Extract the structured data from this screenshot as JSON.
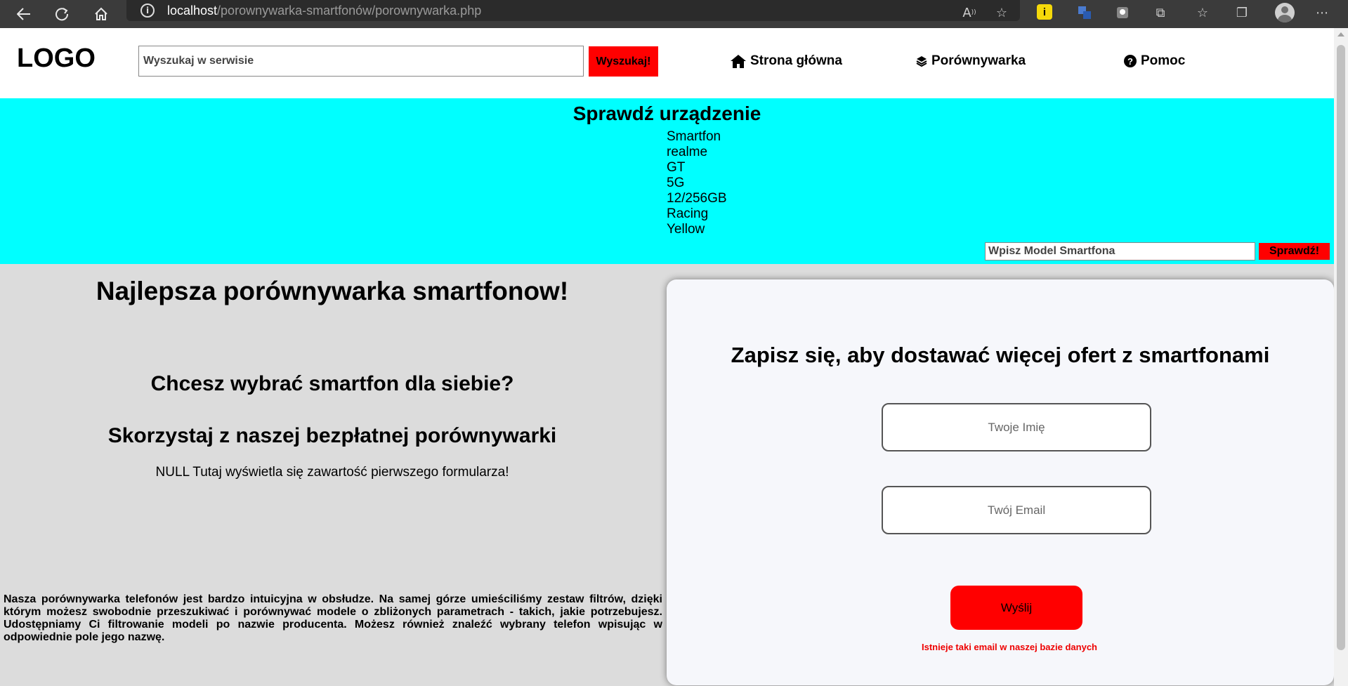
{
  "browser": {
    "url_host": "localhost",
    "url_path": "/porownywarka-smartfonów/porownywarka.php"
  },
  "header": {
    "logo": "LOGO",
    "search": {
      "placeholder": "Wyszukaj w serwisie",
      "button": "Wyszukaj!"
    },
    "nav": [
      {
        "label": "Strona główna",
        "icon": "home-icon"
      },
      {
        "label": "Porównywarka",
        "icon": "layers-icon"
      },
      {
        "label": "Pomoc",
        "icon": "question-icon"
      }
    ]
  },
  "device_check": {
    "title": "Sprawdź urządzenie",
    "lines": [
      "Smartfon",
      "realme",
      "GT",
      "5G",
      "12/256GB",
      "Racing",
      "Yellow"
    ],
    "input_placeholder": "Wpisz Model Smartfona",
    "button": "Sprawdź!"
  },
  "main": {
    "title": "Najlepsza porównywarka smartfonow!",
    "subtitle1": "Chcesz wybrać smartfon dla siebie?",
    "subtitle2": "Skorzystaj z naszej bezpłatnej porównywarki",
    "info": "NULL Tutaj wyświetla się zawartość pierwszego formularza!",
    "description": "Nasza porównywarka telefonów jest bardzo intuicyjna w obsłudze. Na samej górze umieściliśmy zestaw filtrów, dzięki którym możesz swobodnie przeszukiwać i porównywać modele o zbliżonych parametrach - takich, jakie potrzebujesz. Udostępniamy Ci filtrowanie modeli po nazwie producenta. Możesz również znaleźć wybrany telefon wpisując w odpowiednie pole jego nazwę."
  },
  "signup": {
    "title": "Zapisz się, aby dostawać więcej ofert z smartfonami",
    "name_placeholder": "Twoje Imię",
    "email_placeholder": "Twój Email",
    "button": "Wyślij",
    "message": "Istnieje taki email w naszej bazie danych"
  },
  "colors": {
    "accent_red": "#ff0000",
    "banner_cyan": "#00ffff",
    "content_gray": "#dcdcdc",
    "error_red": "#ee0000"
  }
}
